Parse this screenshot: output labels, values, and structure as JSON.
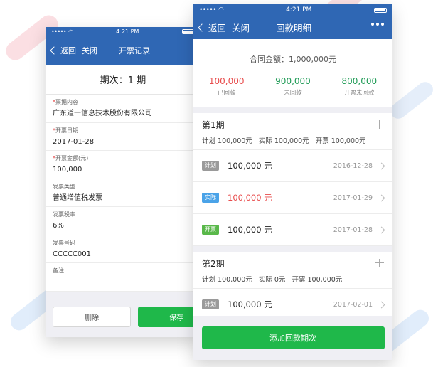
{
  "colors": {
    "nav_blue": "#2f67b4",
    "green_button": "#1fb84a",
    "returned_red": "#e84c4c",
    "unreturned_green": "#1f9b56",
    "tag_plan_gray": "#9a9a9a",
    "tag_actual_blue": "#4aa3e8",
    "tag_invoice_green": "#59b84a"
  },
  "left_phone": {
    "status": {
      "signal": "•••••",
      "wifi": "wifi-icon",
      "time": "4:21 PM"
    },
    "nav": {
      "back_label": "返回",
      "close_label": "关闭",
      "title": "开票记录"
    },
    "period_title": "期次：1 期",
    "fields": [
      {
        "label": "票据内容",
        "required": "*",
        "value": "广东道一信息技术股份有限公司"
      },
      {
        "label": "开票日期",
        "required": "*",
        "value": "2017-01-28"
      },
      {
        "label": "开票金额(元)",
        "required": "*",
        "value": "100,000"
      },
      {
        "label": "发票类型",
        "required": "",
        "value": "普通增值税发票"
      },
      {
        "label": "发票税率",
        "required": "",
        "value": "6%"
      },
      {
        "label": "发票号码",
        "required": "",
        "value": "CCCCC001"
      },
      {
        "label": "备注",
        "required": "",
        "value": ""
      }
    ],
    "buttons": {
      "delete_label": "删除",
      "save_label": "保存"
    }
  },
  "right_phone": {
    "status": {
      "signal": "•••••",
      "wifi": "wifi-icon",
      "time": "4:21 PM"
    },
    "nav": {
      "back_label": "返回",
      "close_label": "关闭",
      "title": "回款明细",
      "more_icon": "more-dots-icon"
    },
    "contract_amount": "合同金额：1,000,000元",
    "stats": [
      {
        "value": "100,000",
        "label": "已回款",
        "color": "#e84c4c"
      },
      {
        "value": "900,000",
        "label": "未回款",
        "color": "#1f9b56"
      },
      {
        "value": "800,000",
        "label": "开票未回款",
        "color": "#1f9b56"
      }
    ],
    "periods": [
      {
        "title": "第1期",
        "summary": "计划 100,000元   实际 100,000元   开票 100,000元",
        "items": [
          {
            "tag": "计划",
            "tag_color": "#9a9a9a",
            "amount": "100,000 元",
            "amount_color": "#222222",
            "date": "2016-12-28"
          },
          {
            "tag": "实际",
            "tag_color": "#4aa3e8",
            "amount": "100,000 元",
            "amount_color": "#e84c4c",
            "date": "2017-01-29"
          },
          {
            "tag": "开票",
            "tag_color": "#59b84a",
            "amount": "100,000 元",
            "amount_color": "#222222",
            "date": "2017-01-28"
          }
        ]
      },
      {
        "title": "第2期",
        "summary": "计划 100,000元   实际 0元   开票 100,000元",
        "items": [
          {
            "tag": "计划",
            "tag_color": "#9a9a9a",
            "amount": "100,000 元",
            "amount_color": "#222222",
            "date": "2017-02-01"
          }
        ]
      }
    ],
    "add_button_label": "添加回款期次"
  }
}
